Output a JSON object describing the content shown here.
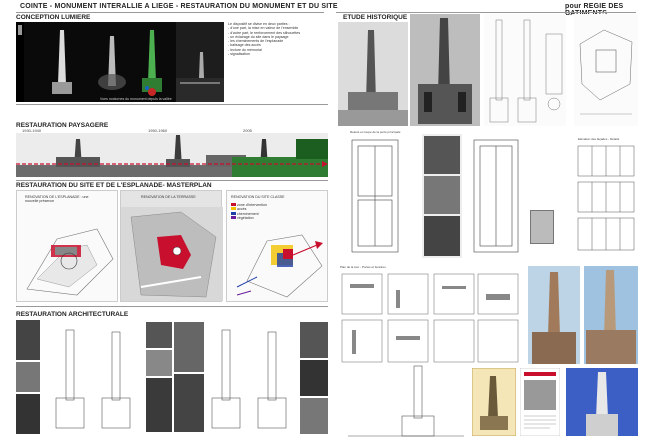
{
  "header": {
    "left_title": "COINTE - MONUMENT INTERALLIE A LIEGE - RESTAURATION DU MONUMENT ET DU SITE",
    "right_title": "pour REGIE DES BATIMENTS"
  },
  "sections": {
    "lumiere": {
      "title": "CONCEPTION LUMIERE",
      "notes": [
        "Le dispositif se divise en deux parties :",
        "- d'une part, la mise en valeur de l'ensemble",
        "- d'autre part, le renforcement des silhouettes",
        "- un éclairage du site dans le paysage",
        "- les cheminements de l'esplanade",
        "- balisage des accès",
        "- lecture du mémorial",
        "- signalisation"
      ],
      "caption": "Vues nocturnes du monument depuis la vallée"
    },
    "paysagere": {
      "title": "RESTAURATION PAYSAGERE",
      "years": [
        "1930-1940",
        "1950-1960",
        "2005"
      ]
    },
    "masterplan": {
      "title": "RESTAURATION DU SITE ET DE L'ESPLANADE- MASTERPLAN",
      "sub_left": "RENOVATION DE L'ESPLANADE : une nouvelle présence",
      "sub_mid": "RENOVATION DE LA TERRASSE",
      "sub_right": "RENOVATION DU SITE CLASSE",
      "legend": [
        "zone d'intervention",
        "accès",
        "cheminement",
        "végétation"
      ]
    },
    "architecturale": {
      "title": "RESTAURATION ARCHITECTURALE"
    },
    "historique": {
      "title": "ETUDE HISTORIQUE"
    },
    "details": {
      "plan_caption": "Plan de la tour - Portes et fenêtres",
      "detail_caption": "Relevé et coupe de la porte principale",
      "facade_caption": "Elévation des façades - Détails"
    }
  },
  "colors": {
    "accent_red": "#c8102e",
    "accent_blue": "#1f3fa8",
    "dark": "#111111"
  }
}
